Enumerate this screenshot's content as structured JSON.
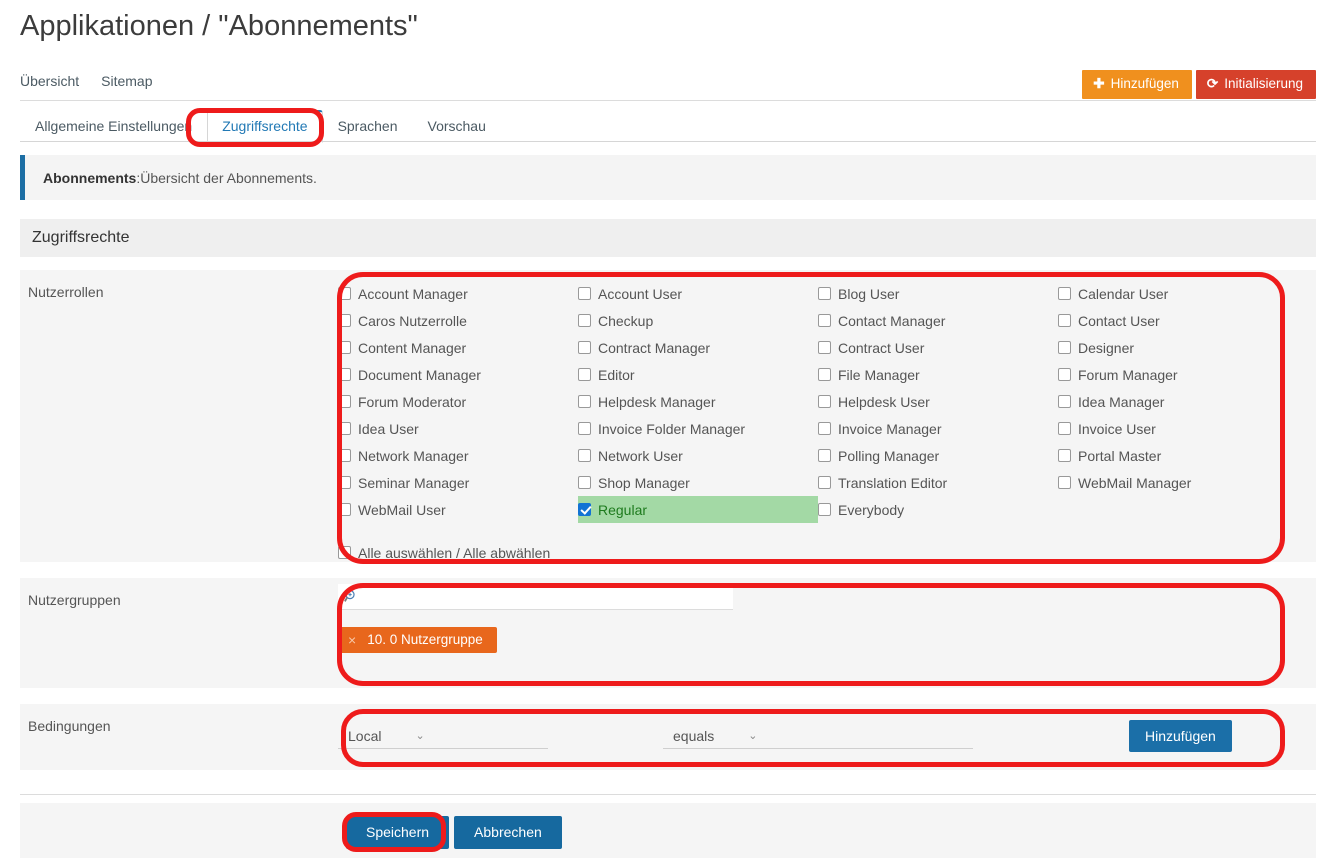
{
  "header": {
    "title": "Applikationen / \"Abonnements\""
  },
  "topnav": {
    "items": [
      {
        "label": "Übersicht"
      },
      {
        "label": "Sitemap"
      }
    ]
  },
  "actions": {
    "add": {
      "label": "Hinzufügen",
      "icon": "plus-icon",
      "glyph": "✚",
      "color": "#f0901e"
    },
    "init": {
      "label": "Initialisierung",
      "icon": "refresh-icon",
      "glyph": "⟳",
      "color": "#d6412b"
    }
  },
  "tabs": [
    {
      "label": "Allgemeine Einstellungen",
      "active": false
    },
    {
      "label": "Zugriffsrechte",
      "active": true
    },
    {
      "label": "Sprachen",
      "active": false
    },
    {
      "label": "Vorschau",
      "active": false
    }
  ],
  "infobar": {
    "name": "Abonnements",
    "separator": ": ",
    "description": "Übersicht der Abonnements.",
    "accent": "#1c6ea4"
  },
  "section": {
    "title": "Zugriffsrechte"
  },
  "rows": {
    "roles_label": "Nutzerrollen",
    "groups_label": "Nutzergruppen",
    "conditions_label": "Bedingungen"
  },
  "roles": {
    "items": [
      {
        "label": "Account Manager",
        "checked": false,
        "highlight": false
      },
      {
        "label": "Account User",
        "checked": false,
        "highlight": false
      },
      {
        "label": "Blog User",
        "checked": false,
        "highlight": false
      },
      {
        "label": "Calendar User",
        "checked": false,
        "highlight": false
      },
      {
        "label": "Caros Nutzerrolle",
        "checked": false,
        "highlight": false
      },
      {
        "label": "Checkup",
        "checked": false,
        "highlight": false
      },
      {
        "label": "Contact Manager",
        "checked": false,
        "highlight": false
      },
      {
        "label": "Contact User",
        "checked": false,
        "highlight": false
      },
      {
        "label": "Content Manager",
        "checked": false,
        "highlight": false
      },
      {
        "label": "Contract Manager",
        "checked": false,
        "highlight": false
      },
      {
        "label": "Contract User",
        "checked": false,
        "highlight": false
      },
      {
        "label": "Designer",
        "checked": false,
        "highlight": false
      },
      {
        "label": "Document Manager",
        "checked": false,
        "highlight": false
      },
      {
        "label": "Editor",
        "checked": false,
        "highlight": false
      },
      {
        "label": "File Manager",
        "checked": false,
        "highlight": false
      },
      {
        "label": "Forum Manager",
        "checked": false,
        "highlight": false
      },
      {
        "label": "Forum Moderator",
        "checked": false,
        "highlight": false
      },
      {
        "label": "Helpdesk Manager",
        "checked": false,
        "highlight": false
      },
      {
        "label": "Helpdesk User",
        "checked": false,
        "highlight": false
      },
      {
        "label": "Idea Manager",
        "checked": false,
        "highlight": false
      },
      {
        "label": "Idea User",
        "checked": false,
        "highlight": false
      },
      {
        "label": "Invoice Folder Manager",
        "checked": false,
        "highlight": false
      },
      {
        "label": "Invoice Manager",
        "checked": false,
        "highlight": false
      },
      {
        "label": "Invoice User",
        "checked": false,
        "highlight": false
      },
      {
        "label": "Network Manager",
        "checked": false,
        "highlight": false
      },
      {
        "label": "Network User",
        "checked": false,
        "highlight": false
      },
      {
        "label": "Polling Manager",
        "checked": false,
        "highlight": false
      },
      {
        "label": "Portal Master",
        "checked": false,
        "highlight": false
      },
      {
        "label": "Seminar Manager",
        "checked": false,
        "highlight": false
      },
      {
        "label": "Shop Manager",
        "checked": false,
        "highlight": false
      },
      {
        "label": "Translation Editor",
        "checked": false,
        "highlight": false
      },
      {
        "label": "WebMail Manager",
        "checked": false,
        "highlight": false
      },
      {
        "label": "WebMail User",
        "checked": false,
        "highlight": false
      },
      {
        "label": "Regular",
        "checked": true,
        "highlight": true
      },
      {
        "label": "Everybody",
        "checked": false,
        "highlight": false
      }
    ],
    "select_all": {
      "label": "Alle auswählen / Alle abwählen",
      "checked": false
    },
    "highlight_color": "#a3d9a5",
    "highlight_text_color": "#1e7b1e",
    "checkbox_checked_color": "#1273d4"
  },
  "groups": {
    "search": {
      "value": "",
      "placeholder": "",
      "icon": "search-zoom-icon"
    },
    "tags": [
      {
        "label": "10. 0 Nutzergruppe",
        "remove": "×",
        "color": "#e8671c"
      }
    ]
  },
  "conditions": {
    "field_select": {
      "value": "Local",
      "chevron": "⌄"
    },
    "operator_select": {
      "value": "equals",
      "chevron": "⌄"
    },
    "add_button": {
      "label": "Hinzufügen",
      "color": "#1b6fa8"
    }
  },
  "footer": {
    "save": {
      "label": "Speichern"
    },
    "cancel": {
      "label": "Abbrechen"
    }
  },
  "annotations": {
    "color": "#ee1b1b",
    "targets": [
      "tab-zugriffsrechte",
      "nutzerrollen-grid",
      "nutzergruppen-box",
      "bedingungen-box",
      "speichern-button"
    ]
  }
}
